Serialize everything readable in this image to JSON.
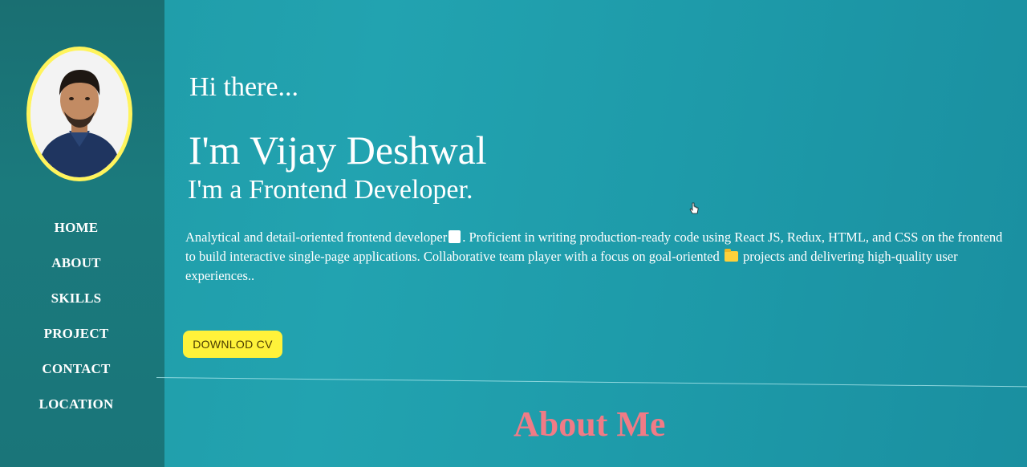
{
  "sidebar": {
    "nav": [
      "HOME",
      "ABOUT",
      "SKILLS",
      "PROJECT",
      "CONTACT",
      "LOCATION"
    ]
  },
  "hero": {
    "greeting": "Hi there...",
    "name": "I'm Vijay Deshwal",
    "role": "I'm a Frontend Developer.",
    "bio_part1": "Analytical and detail-oriented frontend developer",
    "bio_part2": ". Proficient in writing production-ready code using React JS, Redux, HTML, and CSS on the frontend to build interactive single-page applications. Collaborative team player with a focus on goal-oriented",
    "bio_part3": "projects and delivering high-quality user experiences..",
    "cv_button": "DOWNLOD CV"
  },
  "about": {
    "title": "About Me"
  },
  "colors": {
    "sidebar": "#1a7579",
    "main": "#1f9aa6",
    "avatar_ring": "#fff45c",
    "button": "#fff23a",
    "about_title": "#f07b86"
  },
  "icons": [
    "document-emoji-icon",
    "folder-emoji-icon",
    "hand-cursor-icon"
  ]
}
